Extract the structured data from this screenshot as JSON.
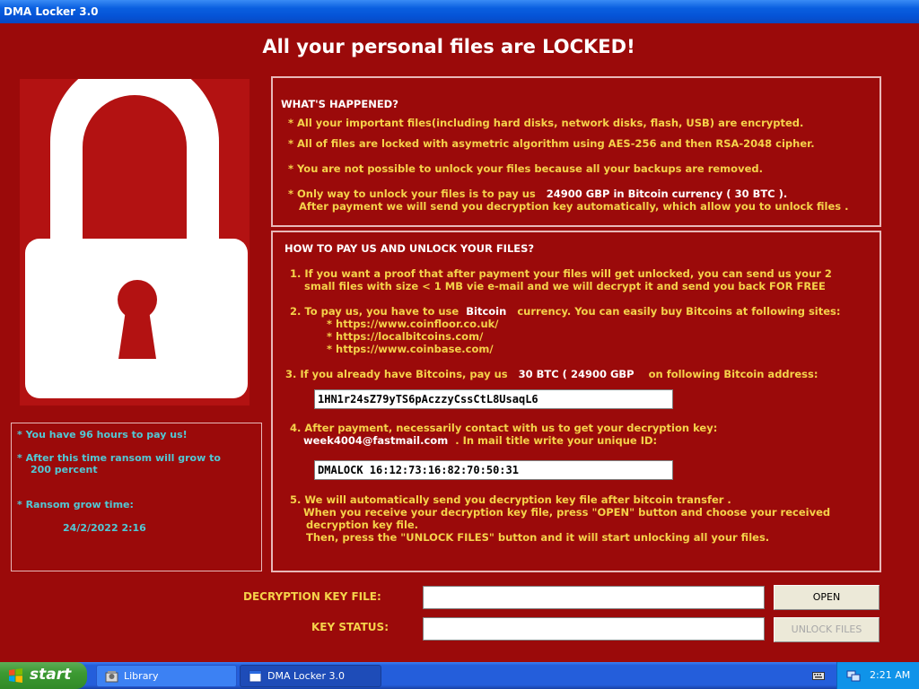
{
  "window": {
    "title": "DMA Locker 3.0"
  },
  "headline": "All your personal files are LOCKED!",
  "countdown": {
    "line1": "* You have 96 hours to pay us!",
    "line2a": "* After this time ransom will grow to",
    "line2b": "200 percent",
    "line3": "* Ransom grow time:",
    "date": "24/2/2022 2:16"
  },
  "happened": {
    "heading": "WHAT'S HAPPENED?",
    "line1": "*  All your important files(including hard disks, network disks, flash, USB) are encrypted.",
    "line2": "*  All of files are locked with asymetric algorithm using AES-256 and then RSA-2048 cipher.",
    "line3": "*  You are not possible to unlock your files because all your backups are removed.",
    "line4_prefix": "*  Only way to unlock your files is to pay us",
    "line4_amount": "24900 GBP",
    "line4_suffix": "in Bitcoin currency (  30 BTC ).",
    "line5": "After payment we will send you decryption key automatically, which allow you to unlock files ."
  },
  "howto": {
    "heading": "HOW TO PAY US AND UNLOCK YOUR FILES?",
    "step1a": "1. If you want a proof that after payment your files will get unlocked, you can send us your 2",
    "step1b": "small files with size < 1 MB vie e-mail and we will decrypt it and send you back FOR FREE",
    "step2_prefix": "2. To pay us, you have to use",
    "step2_word": "Bitcoin",
    "step2_suffix": "currency. You can easily buy Bitcoins at following sites:",
    "site1": "* https://www.coinfloor.co.uk/",
    "site2": "* https://localbitcoins.com/",
    "site3": "* https://www.coinbase.com/",
    "step3_prefix": "3. If you already have Bitcoins, pay us",
    "step3_amount": "30 BTC (  24900 GBP",
    "step3_suffix": "on following Bitcoin address:",
    "btc_address": "1HN1r24sZ79yTS6pAczzyCssCtL8UsaqL6",
    "step4a": "4. After payment, necessarily contact with us to get your decryption key:",
    "step4_email": "week4004@fastmail.com",
    "step4b": ". In mail title write your unique ID:",
    "unique_id": "DMALOCK 16:12:73:16:82:70:50:31",
    "step5a": "5. We will automatically send you decryption key file after bitcoin transfer .",
    "step5b": "When you receive your decryption key file, press  \"OPEN\"   button and choose your received",
    "step5c": "decryption key file.",
    "step5d": "Then,  press the \"UNLOCK FILES\" button and it will start unlocking all your files."
  },
  "controls": {
    "key_file_label": "DECRYPTION KEY FILE:",
    "key_file_value": "",
    "key_status_label": "KEY STATUS:",
    "key_status_value": "",
    "open_label": "OPEN",
    "unlock_label": "UNLOCK FILES"
  },
  "taskbar": {
    "start_label": "start",
    "tasks": [
      {
        "label": "Library"
      },
      {
        "label": "DMA Locker 3.0"
      }
    ],
    "clock": "2:21 AM"
  },
  "colors": {
    "background": "#9b0a0a",
    "text_yellow": "#f5d24a",
    "text_cyan": "#52c8d4",
    "frame": "#e8b8b8"
  }
}
